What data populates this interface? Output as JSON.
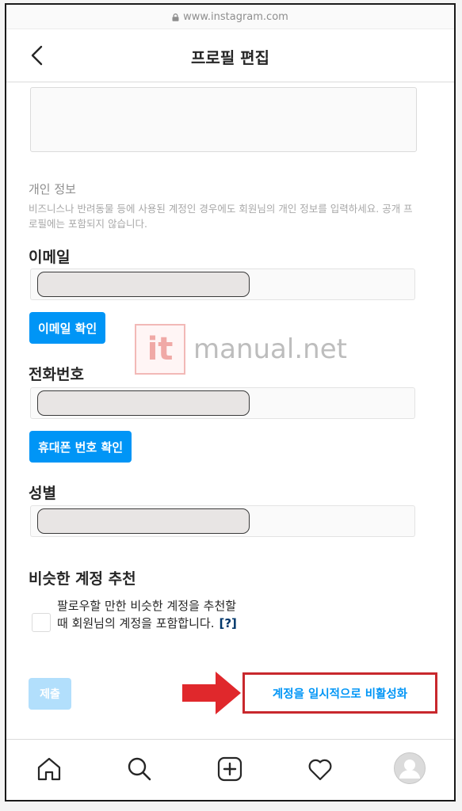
{
  "browser": {
    "url": "www.instagram.com"
  },
  "header": {
    "title": "프로필 편집"
  },
  "personal_info": {
    "label": "개인 정보",
    "description": "비즈니스나 반려동물 등에 사용된 계정인 경우에도 회원님의 개인 정보를 입력하세요. 공개 프로필에는 포함되지 않습니다."
  },
  "email": {
    "label": "이메일",
    "value": "",
    "confirm_button": "이메일 확인"
  },
  "phone": {
    "label": "전화번호",
    "value": "",
    "confirm_button": "휴대폰 번호 확인"
  },
  "gender": {
    "label": "성별",
    "value": ""
  },
  "suggestions": {
    "label": "비슷한 계정 추천",
    "checkbox_text": "팔로우할 만한 비슷한 계정을 추천할 때 회원님의 계정을 포함합니다.",
    "help_link": "[?]",
    "checked": false
  },
  "actions": {
    "submit": "제출",
    "deactivate": "계정을 일시적으로 비활성화"
  },
  "watermark": {
    "mark": "it",
    "text": "manual.net"
  },
  "bottom_nav": [
    "home-icon",
    "search-icon",
    "new-post-icon",
    "heart-icon",
    "profile-avatar-icon"
  ],
  "colors": {
    "primary": "#0095f6",
    "primary_disabled": "#b2dffc",
    "annotation_red": "#c8282d",
    "link_dark": "#00376b"
  }
}
